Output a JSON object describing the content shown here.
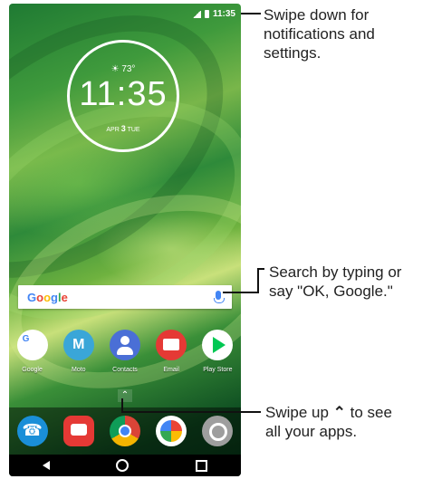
{
  "status": {
    "time": "11:35"
  },
  "clock_widget": {
    "weather": "73°",
    "time": "11:35",
    "month": "APR",
    "day": "3",
    "weekday": "TUE"
  },
  "search": {
    "logo": "Google"
  },
  "apps": [
    {
      "label": "Google",
      "icon": "google-folder-icon"
    },
    {
      "label": "Moto",
      "icon": "moto-icon"
    },
    {
      "label": "Contacts",
      "icon": "contacts-icon"
    },
    {
      "label": "Email",
      "icon": "email-icon"
    },
    {
      "label": "Play Store",
      "icon": "play-store-icon"
    }
  ],
  "dock": [
    "phone-icon",
    "messages-icon",
    "chrome-icon",
    "photos-icon",
    "camera-icon"
  ],
  "callouts": {
    "notifications": "Swipe down for notifications and settings.",
    "search_pre": "Search by typing or",
    "search_post": "say \"OK, Google.\"",
    "apps_pre": "Swipe up",
    "apps_mid": "to see",
    "apps_post": "all your apps."
  }
}
